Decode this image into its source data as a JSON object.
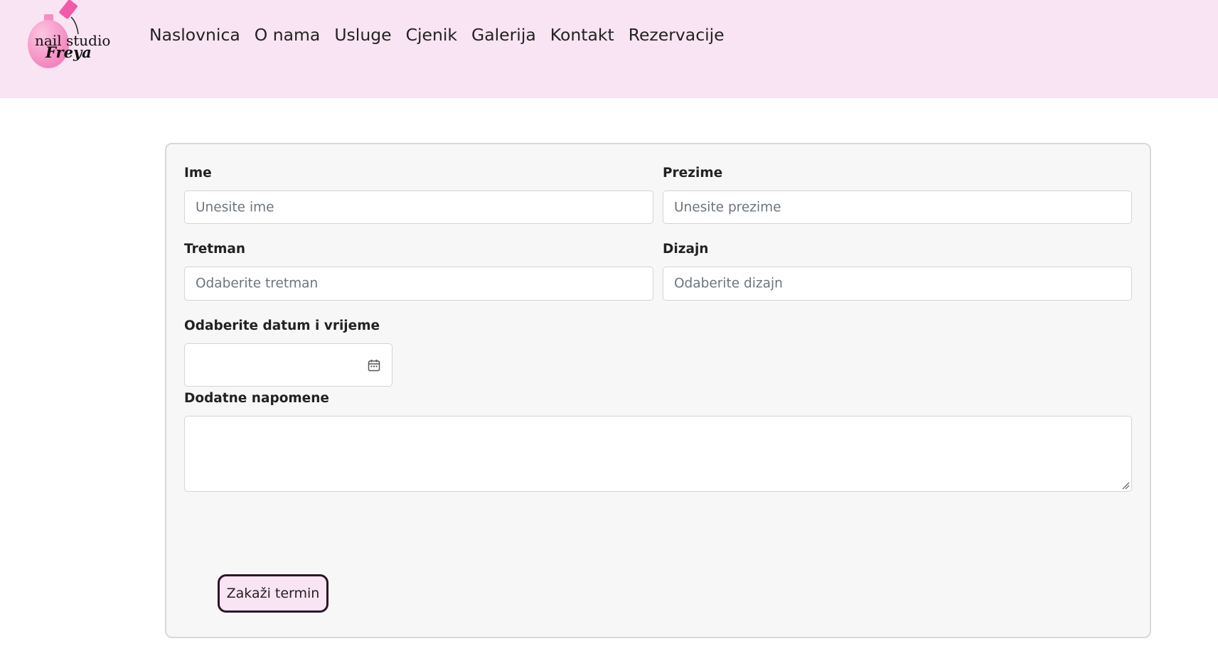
{
  "brand": {
    "logo_line1": "nail studio",
    "logo_line2": "Freya",
    "accent_pink": "#f06ab0",
    "header_bg": "#f8e4f2"
  },
  "nav": {
    "items": [
      {
        "label": "Naslovnica"
      },
      {
        "label": "O nama"
      },
      {
        "label": "Usluge"
      },
      {
        "label": "Cjenik"
      },
      {
        "label": "Galerija"
      },
      {
        "label": "Kontakt"
      },
      {
        "label": "Rezervacije"
      }
    ]
  },
  "form": {
    "first_name": {
      "label": "Ime",
      "placeholder": "Unesite ime",
      "value": ""
    },
    "last_name": {
      "label": "Prezime",
      "placeholder": "Unesite prezime",
      "value": ""
    },
    "treatment": {
      "label": "Tretman",
      "placeholder": "Odaberite tretman",
      "value": ""
    },
    "design": {
      "label": "Dizajn",
      "placeholder": "Odaberite dizajn",
      "value": ""
    },
    "datetime": {
      "label": "Odaberite datum i vrijeme",
      "value": "",
      "icon": "calendar-icon"
    },
    "notes": {
      "label": "Dodatne napomene",
      "value": ""
    },
    "submit_label": "Zakaži termin"
  }
}
